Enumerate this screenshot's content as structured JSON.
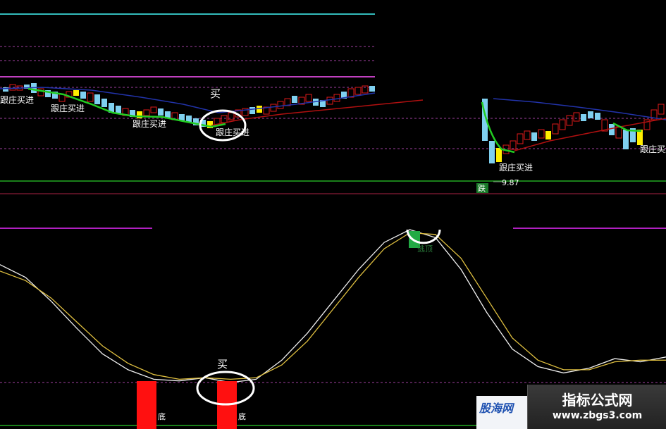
{
  "colors": {
    "background": "#000000",
    "up_candle": "#e01a1a",
    "down_candle": "#7fd0f0",
    "yellow_candle": "#ffee00",
    "track_ma": "#22cc22",
    "slow_ma": "#b01010",
    "blue_ma": "#2233aa",
    "dashed_line": "#a040a0",
    "cyan_line": "#33bbbb",
    "k_line": "#f0f0f0",
    "d_line": "#e0c040",
    "bottom_bar": "#ff1010",
    "top_marker": "#22aa44"
  },
  "price_panel": {
    "signal_label": "跟庄买进",
    "buy_label": "买",
    "price_note": "9.87",
    "drop_label": "跌"
  },
  "indicator_panel": {
    "bottom_label": "底",
    "buy_label": "买",
    "top_label": "逃顶"
  },
  "watermark": {
    "title": "指标公式网",
    "url": "www.zbgs3.com",
    "logo": "股海网"
  },
  "chart_data": [
    {
      "type": "line",
      "panel": "price",
      "series": [
        {
          "values": [
            10.9,
            10.7,
            10.55,
            10.4,
            10.2,
            10.1,
            10.35,
            10.5,
            10.65,
            10.8,
            10.95,
            11.1
          ]
        },
        {
          "values": [
            10.85,
            10.8,
            10.7,
            10.6,
            10.45,
            10.4,
            10.5,
            10.6,
            10.7,
            10.75,
            10.85,
            10.95
          ]
        }
      ],
      "annotations": [
        "跟庄买进",
        "跟庄买进",
        "跟庄买进",
        "跟庄买进",
        "跟庄买进",
        "跟庄买进",
        "9.87",
        "买",
        "跌"
      ]
    },
    {
      "type": "line",
      "panel": "indicator",
      "series": [
        {
          "values": [
            78,
            70,
            55,
            38,
            22,
            12,
            6,
            5,
            7,
            4,
            6,
            18,
            35,
            55,
            75,
            92,
            100,
            95,
            75,
            48,
            25,
            14,
            10,
            13,
            19,
            17,
            20
          ]
        },
        {
          "values": [
            74,
            68,
            57,
            42,
            27,
            16,
            9,
            6,
            7,
            6,
            7,
            15,
            30,
            50,
            70,
            88,
            98,
            97,
            82,
            57,
            32,
            18,
            12,
            12,
            17,
            18,
            18
          ]
        }
      ],
      "annotations": [
        "底",
        "底",
        "买",
        "逃顶"
      ]
    }
  ]
}
